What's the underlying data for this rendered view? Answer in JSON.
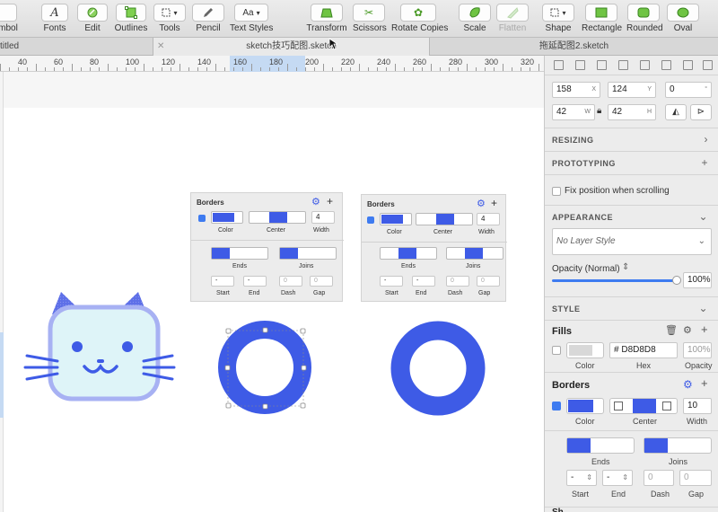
{
  "toolbar": {
    "items": [
      {
        "label": "mbol",
        "icon": "symbol-icon"
      },
      {
        "label": "Fonts",
        "icon": "fonts-icon"
      },
      {
        "label": "Edit",
        "icon": "edit-icon"
      },
      {
        "label": "Outlines",
        "icon": "outlines-icon"
      },
      {
        "label": "Tools",
        "icon": "tools-icon"
      },
      {
        "label": "Pencil",
        "icon": "pencil-icon"
      },
      {
        "label": "Text Styles",
        "icon": "text-styles-icon",
        "btn_text": "Aa"
      },
      {
        "label": "Transform",
        "icon": "transform-icon"
      },
      {
        "label": "Scissors",
        "icon": "scissors-icon"
      },
      {
        "label": "Rotate Copies",
        "icon": "rotate-copies-icon"
      },
      {
        "label": "Scale",
        "icon": "scale-icon"
      },
      {
        "label": "Flatten",
        "icon": "flatten-icon"
      },
      {
        "label": "Shape",
        "icon": "shape-icon"
      },
      {
        "label": "Rectangle",
        "icon": "rectangle-icon"
      },
      {
        "label": "Rounded",
        "icon": "rounded-icon"
      },
      {
        "label": "Oval",
        "icon": "oval-icon"
      }
    ]
  },
  "tabs": {
    "left": "titled",
    "active": "sketch技巧配图.sketch",
    "right": "拖延配图2.sketch"
  },
  "ruler": {
    "ticks": [
      "40",
      "60",
      "80",
      "100",
      "120",
      "140",
      "160",
      "180",
      "200",
      "220",
      "240",
      "260",
      "280",
      "300",
      "320"
    ]
  },
  "mini_panel": {
    "title": "Borders",
    "color_label": "Color",
    "position_label": "Center",
    "width_label": "Width",
    "width_left": "4",
    "width_right": "4",
    "ends_label": "Ends",
    "joins_label": "Joins",
    "start_label": "Start",
    "end_label": "End",
    "dash_label": "Dash",
    "gap_label": "Gap",
    "start_value": "-",
    "end_value": "-",
    "dash_value": "0",
    "gap_value": "0"
  },
  "inspector": {
    "x": "158",
    "x_unit": "X",
    "y": "124",
    "y_unit": "Y",
    "rotation": "0",
    "rotation_unit": "°",
    "w": "42",
    "w_unit": "W",
    "h": "42",
    "h_unit": "H",
    "resizing": "RESIZING",
    "prototyping": "PROTOTYPING",
    "fix_position": "Fix position when scrolling",
    "appearance": "APPEARANCE",
    "layer_style": "No Layer Style",
    "opacity_label": "Opacity (Normal)",
    "opacity_value": "100%",
    "opacity_level": 1.0,
    "style": "STYLE",
    "fills": {
      "title": "Fills",
      "hex": "D8D8D8",
      "hex_prefix": "#",
      "opacity": "100%",
      "color_label": "Color",
      "hex_label": "Hex",
      "opacity_label": "Opacity",
      "swatch_color": "#d8d8d8"
    },
    "borders": {
      "title": "Borders",
      "width": "10",
      "color_label": "Color",
      "position_label": "Center",
      "width_label": "Width",
      "ends_label": "Ends",
      "joins_label": "Joins",
      "start_value": "-",
      "end_value": "-",
      "dash_value": "0",
      "gap_value": "0",
      "start_label": "Start",
      "end_label": "End",
      "dash_label": "Dash",
      "gap_label": "Gap",
      "swatch_color": "#3e5be6"
    },
    "shadows_partial": "Sh"
  },
  "colors": {
    "accent": "#3e5be6",
    "cat_fill": "#def4f8",
    "cat_outline": "#a7b1f3"
  }
}
